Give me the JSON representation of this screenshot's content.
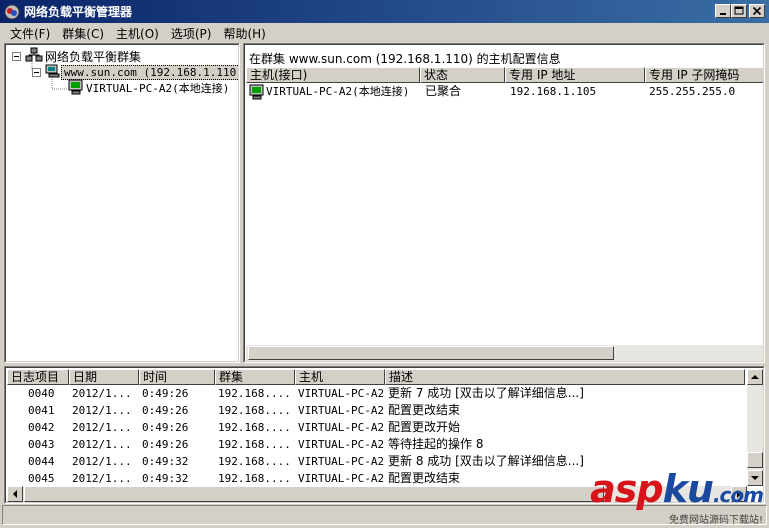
{
  "window": {
    "title": "网络负载平衡管理器"
  },
  "menu": [
    "文件(F)",
    "群集(C)",
    "主机(O)",
    "选项(P)",
    "帮助(H)"
  ],
  "tree": {
    "root": "网络负载平衡群集",
    "cluster": "www.sun.com (192.168.1.110)",
    "host": "VIRTUAL-PC-A2(本地连接)"
  },
  "detail": {
    "caption": "在群集 www.sun.com (192.168.1.110) 的主机配置信息",
    "columns": [
      "主机(接口)",
      "状态",
      "专用 IP 地址",
      "专用 IP 子网掩码"
    ],
    "rows": [
      {
        "host": "VIRTUAL-PC-A2(本地连接)",
        "status": "已聚合",
        "ip": "192.168.1.105",
        "mask": "255.255.255.0"
      }
    ]
  },
  "log": {
    "columns": [
      "日志项目",
      "日期",
      "时间",
      "群集",
      "主机",
      "描述"
    ],
    "rows": [
      {
        "id": "0040",
        "date": "2012/1...",
        "time": "0:49:26",
        "cluster": "192.168....",
        "host": "VIRTUAL-PC-A2",
        "desc": "更新 7 成功 [双击以了解详细信息...]"
      },
      {
        "id": "0041",
        "date": "2012/1...",
        "time": "0:49:26",
        "cluster": "192.168....",
        "host": "VIRTUAL-PC-A2",
        "desc": "配置更改结束"
      },
      {
        "id": "0042",
        "date": "2012/1...",
        "time": "0:49:26",
        "cluster": "192.168....",
        "host": "VIRTUAL-PC-A2",
        "desc": "配置更改开始"
      },
      {
        "id": "0043",
        "date": "2012/1...",
        "time": "0:49:26",
        "cluster": "192.168....",
        "host": "VIRTUAL-PC-A2",
        "desc": "等待挂起的操作 8"
      },
      {
        "id": "0044",
        "date": "2012/1...",
        "time": "0:49:32",
        "cluster": "192.168....",
        "host": "VIRTUAL-PC-A2",
        "desc": "更新 8 成功 [双击以了解详细信息...]"
      },
      {
        "id": "0045",
        "date": "2012/1...",
        "time": "0:49:32",
        "cluster": "192.168....",
        "host": "VIRTUAL-PC-A2",
        "desc": "配置更改结束"
      }
    ]
  },
  "watermark": {
    "brand_a": "asp",
    "brand_b": "ku",
    "brand_c": ".com",
    "tagline": "免费网站源码下载站!"
  },
  "colors": {
    "titlebar": "#0a246a",
    "selection": "#0a246a",
    "watermark_red": "#d8141b",
    "watermark_blue": "#1a4aa0"
  },
  "icons": [
    "app-icon",
    "minimize-icon",
    "maximize-icon",
    "close-icon",
    "cluster-icon",
    "server-icon",
    "host-icon"
  ]
}
